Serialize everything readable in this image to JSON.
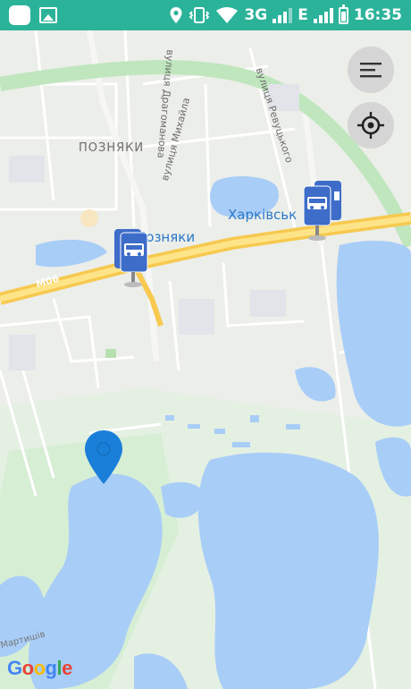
{
  "status_bar": {
    "network": "3G",
    "network_secondary": "E",
    "time": "16:35"
  },
  "map": {
    "labels": {
      "district_poznyaky": "ПОЗНЯКИ",
      "street_drahomanova": "вулиця Драгоманова",
      "street_mykhaila": "вулиця Михайла",
      "street_revutskoho": "вулиця Ревуцького",
      "station_kharkivska": "Харківськ",
      "station_poznyaky": "Позняки",
      "road_m06": "М06",
      "street_martyshiv": "Мартишів"
    },
    "attribution": {
      "g1": "G",
      "g2": "o",
      "g3": "o",
      "g4": "g",
      "g5": "l",
      "g6": "e"
    },
    "colors": {
      "water": "#a8cdf7",
      "highway": "#fbd25b",
      "park": "#cdeecb",
      "pin": "#1a7fd9",
      "stop_sign": "#3d6cc9"
    }
  },
  "controls": {
    "menu_icon": "menu-icon",
    "locate_icon": "crosshair-icon"
  }
}
